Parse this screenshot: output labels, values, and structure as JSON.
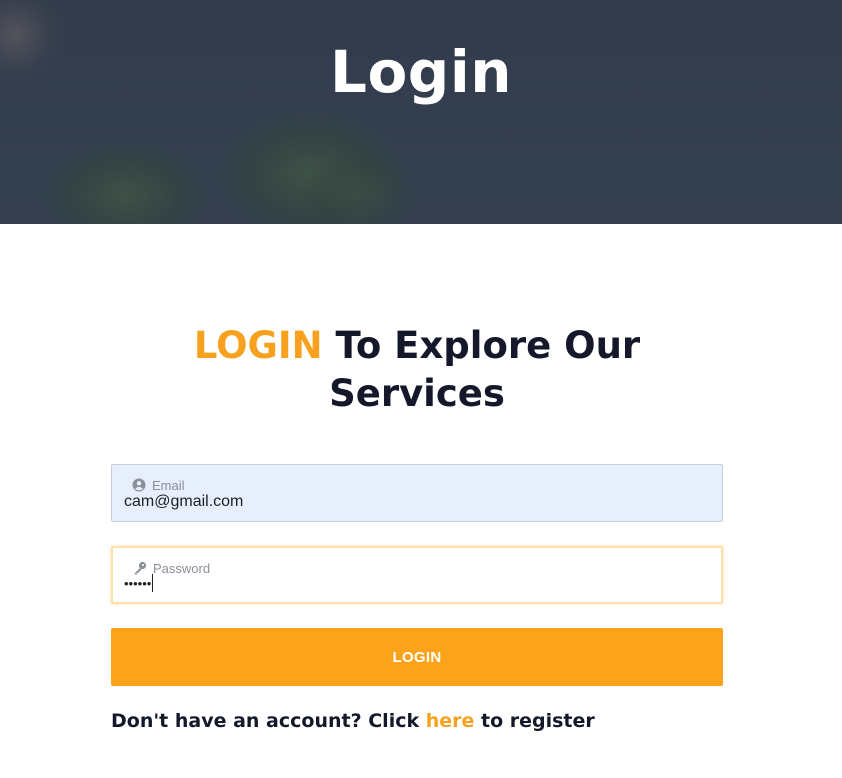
{
  "hero": {
    "title": "Login"
  },
  "heading": {
    "accent": "LOGIN",
    "rest": " To Explore Our Services"
  },
  "form": {
    "email": {
      "label": "Email",
      "value": "cam@gmail.com",
      "icon": "user-circle-icon"
    },
    "password": {
      "label": "Password",
      "value": "••••••",
      "icon": "key-icon"
    },
    "submit_label": "LOGIN"
  },
  "register": {
    "prefix": "Don't have an account? Click ",
    "link": "here",
    "suffix": " to register"
  },
  "colors": {
    "accent": "#f8a11f",
    "button": "#fca31c",
    "heading": "#14182a",
    "email_bg": "#e8effc"
  }
}
